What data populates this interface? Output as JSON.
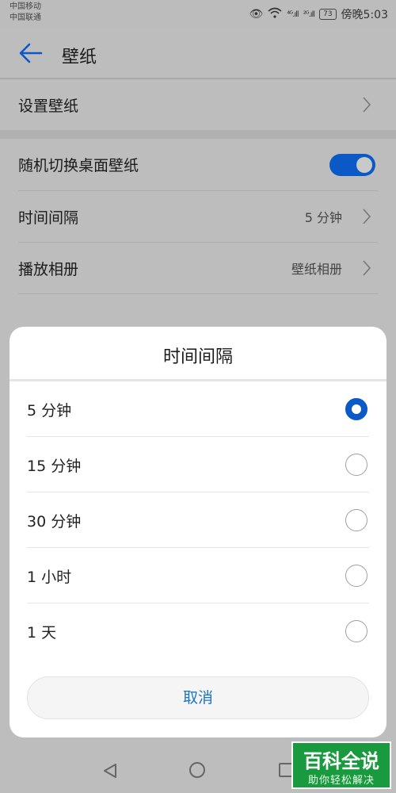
{
  "status_bar": {
    "carrier1": "中国移动",
    "carrier2": "中国联通",
    "signal1": "⁴ᴳ.ıll",
    "signal2": "²ᴳ.ıll",
    "battery": "73",
    "time": "傍晚5:03"
  },
  "header": {
    "title": "壁纸"
  },
  "settings": {
    "set_wallpaper": "设置壁纸",
    "random_switch": "随机切换桌面壁纸",
    "random_switch_on": true,
    "interval_label": "时间间隔",
    "interval_value": "5 分钟",
    "album_label": "播放相册",
    "album_value": "壁纸相册"
  },
  "dialog": {
    "title": "时间间隔",
    "options": [
      {
        "label": "5 分钟",
        "selected": true
      },
      {
        "label": "15 分钟",
        "selected": false
      },
      {
        "label": "30 分钟",
        "selected": false
      },
      {
        "label": "1 小时",
        "selected": false
      },
      {
        "label": "1 天",
        "selected": false
      }
    ],
    "cancel": "取消"
  },
  "watermark": {
    "line1": "百科全说",
    "line2": "助你轻松解决"
  },
  "colors": {
    "accent": "#0a59c6",
    "cancel_text": "#1a74c8",
    "watermark_bg": "#1a9a3e"
  }
}
